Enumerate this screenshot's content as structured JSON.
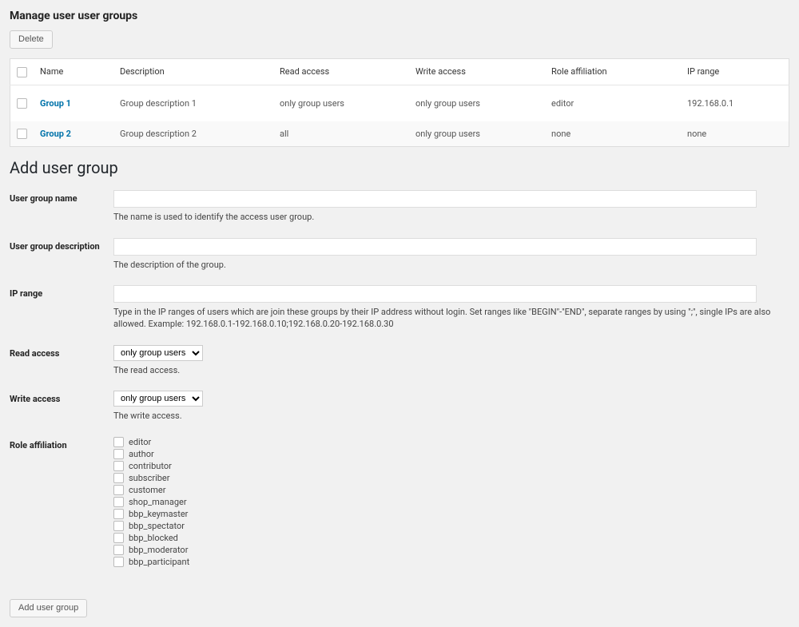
{
  "header": {
    "title": "Manage user user groups",
    "delete_label": "Delete"
  },
  "table": {
    "headers": {
      "name": "Name",
      "description": "Description",
      "read_access": "Read access",
      "write_access": "Write access",
      "role_affiliation": "Role affiliation",
      "ip_range": "IP range"
    },
    "rows": [
      {
        "name": "Group 1",
        "description": "Group description 1",
        "read_access": "only group users",
        "write_access": "only group users",
        "role_affiliation": "editor",
        "ip_range": "192.168.0.1"
      },
      {
        "name": "Group 2",
        "description": "Group description 2",
        "read_access": "all",
        "write_access": "only group users",
        "role_affiliation": "none",
        "ip_range": "none"
      }
    ]
  },
  "section_title": "Add user group",
  "form": {
    "name": {
      "label": "User group name",
      "desc": "The name is used to identify the access user group."
    },
    "description": {
      "label": "User group description",
      "desc": "The description of the group."
    },
    "ip_range": {
      "label": "IP range",
      "desc": "Type in the IP ranges of users which are join these groups by their IP address without login. Set ranges like \"BEGIN\"-\"END\", separate ranges by using \";\", single IPs are also allowed. Example: 192.168.0.1-192.168.0.10;192.168.0.20-192.168.0.30"
    },
    "read_access": {
      "label": "Read access",
      "selected": "only group users",
      "desc": "The read access."
    },
    "write_access": {
      "label": "Write access",
      "selected": "only group users",
      "desc": "The write access."
    },
    "role_affiliation": {
      "label": "Role affiliation",
      "roles": [
        "editor",
        "author",
        "contributor",
        "subscriber",
        "customer",
        "shop_manager",
        "bbp_keymaster",
        "bbp_spectator",
        "bbp_blocked",
        "bbp_moderator",
        "bbp_participant"
      ]
    },
    "submit_label": "Add user group"
  }
}
